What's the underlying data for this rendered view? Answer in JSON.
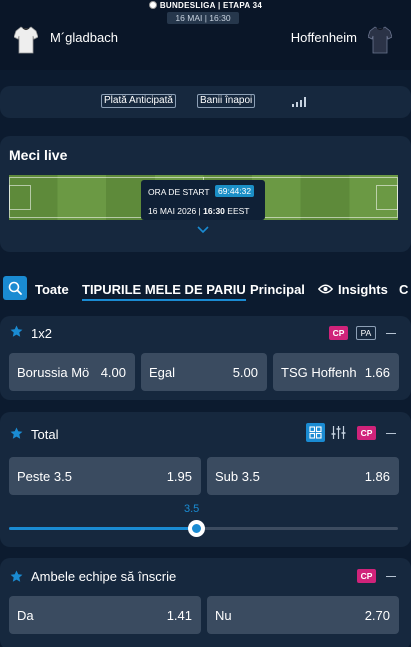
{
  "header": {
    "league": "BUNDESLIGA",
    "separator": "|",
    "round": "ETAPA 34",
    "date_time": "16 MAI | 16:30",
    "home_team": "M´gladbach",
    "away_team": "Hoffenheim"
  },
  "options": {
    "early_payout": "Plată Anticipată",
    "money_back": "Banii înapoi",
    "stats_icon": "bar-chart-icon"
  },
  "live": {
    "title": "Meci live",
    "start_label": "ORA DE START",
    "countdown": "69:44:32",
    "date": "16 MAI 2026 |",
    "time": "16:30",
    "tz": "EEST"
  },
  "tabs": {
    "items": [
      "Toate",
      "TIPURILE MELE DE PARIU",
      "Principal",
      "Insights",
      "C"
    ],
    "active": "TIPURILE MELE DE PARIU"
  },
  "markets": {
    "m1x2": {
      "title": "1x2",
      "badges": [
        "CP",
        "PA"
      ],
      "outcomes": [
        {
          "name": "Borussia Mö",
          "odd": "4.00"
        },
        {
          "name": "Egal",
          "odd": "5.00"
        },
        {
          "name": "TSG Hoffenh",
          "odd": "1.66"
        }
      ]
    },
    "total": {
      "title": "Total",
      "badge": "CP",
      "outcomes": [
        {
          "name": "Peste 3.5",
          "odd": "1.95"
        },
        {
          "name": "Sub 3.5",
          "odd": "1.86"
        }
      ],
      "slider": {
        "value": "3.5",
        "position_fraction": 0.48
      }
    },
    "btts": {
      "title": "Ambele echipe să înscrie",
      "badge": "CP",
      "outcomes": [
        {
          "name": "Da",
          "odd": "1.41"
        },
        {
          "name": "Nu",
          "odd": "2.70"
        }
      ]
    }
  },
  "colors": {
    "background": "#0c1b2f",
    "card": "#16283e",
    "accent": "#1a8bd2",
    "cp_badge": "#d0237a",
    "odd_button": "#3a4b60"
  }
}
